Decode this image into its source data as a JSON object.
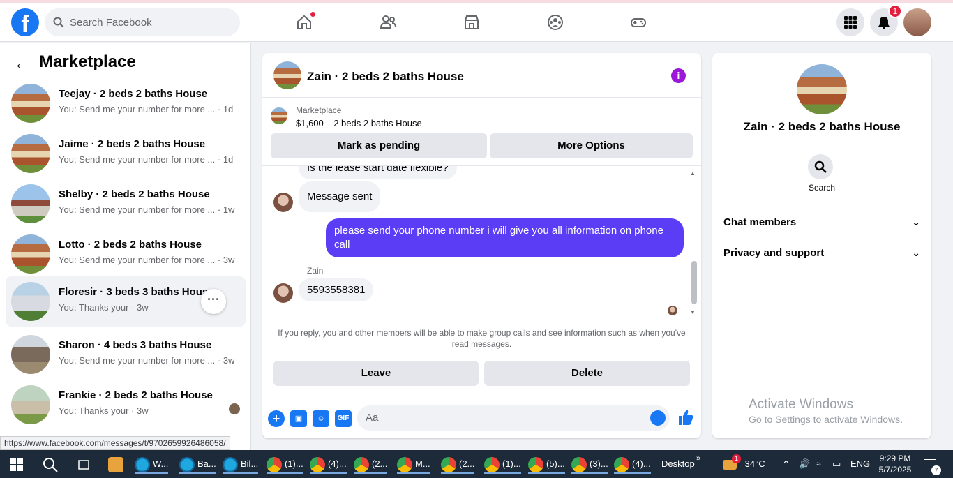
{
  "topbar": {
    "search_placeholder": "Search Facebook",
    "notification_count": "1",
    "nav_icons": [
      "home-icon",
      "friends-icon",
      "marketplace-icon",
      "groups-icon",
      "gaming-icon"
    ]
  },
  "left": {
    "title": "Marketplace",
    "conversations": [
      {
        "title": "Teejay · 2 beds 2 baths House",
        "preview": "You: Send me your number for more ...",
        "time": "· 1d"
      },
      {
        "title": "Jaime · 2 beds 2 baths House",
        "preview": "You: Send me your number for more ...",
        "time": "· 1d"
      },
      {
        "title": "Shelby · 2 beds 2 baths House",
        "preview": "You: Send me your number for more ...",
        "time": "· 1w"
      },
      {
        "title": "Lotto · 2 beds 2 baths House",
        "preview": "You: Send me your number for more ...",
        "time": "· 3w"
      },
      {
        "title": "Floresir · 3 beds 3 baths House",
        "preview": "You: Thanks your",
        "time": "· 3w"
      },
      {
        "title": "Sharon · 4 beds 3 baths House",
        "preview": "You: Send me your number for more ...",
        "time": "· 3w"
      },
      {
        "title": "Frankie · 2 beds 2 baths House",
        "preview": "You: Thanks your",
        "time": "· 3w"
      }
    ],
    "status_url": "https://www.facebook.com/messages/t/9702659926486058/"
  },
  "chat": {
    "title": "Zain · 2 beds 2 baths House",
    "listing_source": "Marketplace",
    "listing_price": "$1,600 – 2 beds 2 baths House",
    "mark_pending": "Mark as pending",
    "more_options": "More Options",
    "messages": {
      "partial": "Is the lease start date flexible?",
      "sent_notice": "Message sent",
      "outgoing": "please send your phone number i will give you all information on phone call",
      "sender": "Zain",
      "incoming": "5593558381"
    },
    "notice": "If you reply, you and other members will be able to make group calls and see information such as when you've read messages.",
    "leave": "Leave",
    "delete": "Delete",
    "composer_placeholder": "Aa",
    "gif": "GIF"
  },
  "right": {
    "title": "Zain · 2 beds 2 baths House",
    "search_label": "Search",
    "chat_members": "Chat members",
    "privacy_support": "Privacy and support"
  },
  "watermark": {
    "line1": "Activate Windows",
    "line2": "Go to Settings to activate Windows."
  },
  "taskbar": {
    "items": [
      "W...",
      "Ba...",
      "Bil...",
      "(1)...",
      "(4)...",
      "(2...",
      "M...",
      "(2...",
      "(1)...",
      "(5)...",
      "(3)...",
      "(4)..."
    ],
    "desktop": "Desktop",
    "weather_badge": "1",
    "temperature": "34°C",
    "language": "ENG",
    "time": "9:29 PM",
    "date": "5/7/2025",
    "notif_count": "7"
  }
}
